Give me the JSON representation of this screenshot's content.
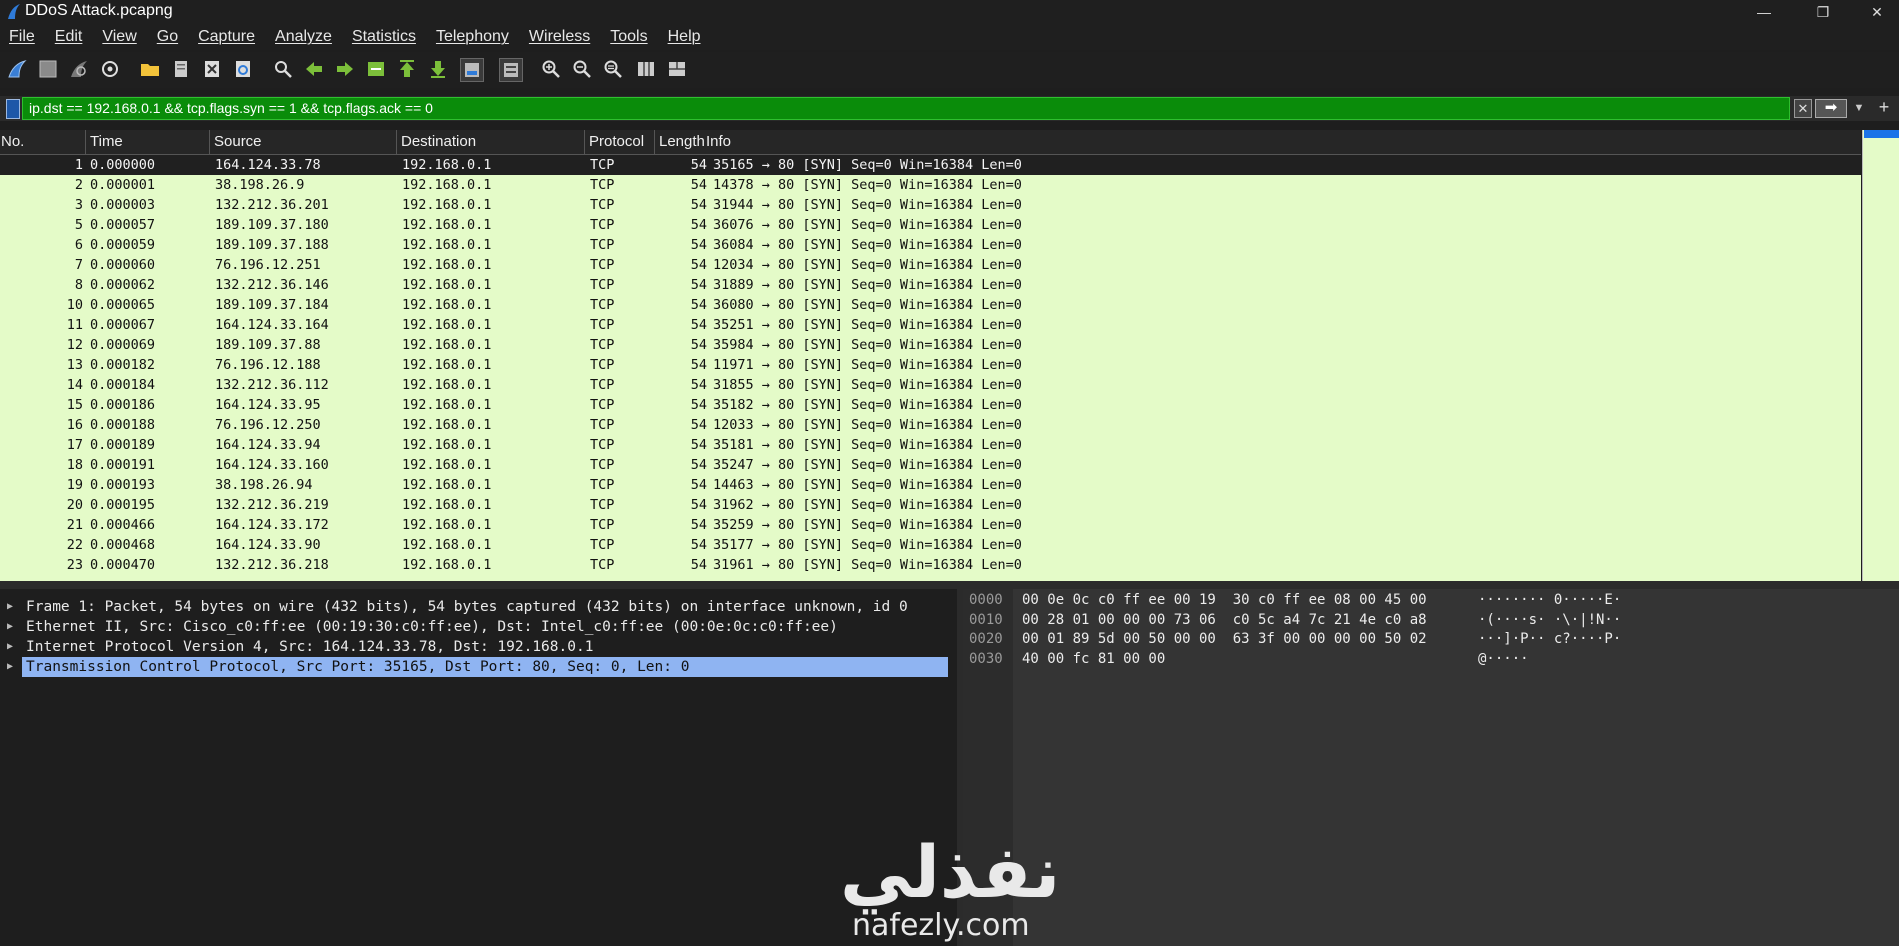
{
  "window": {
    "title": "DDoS Attack.pcapng",
    "minimize": "—",
    "restore": "❐",
    "close": "✕"
  },
  "menu": [
    "File",
    "Edit",
    "View",
    "Go",
    "Capture",
    "Analyze",
    "Statistics",
    "Telephony",
    "Wireless",
    "Tools",
    "Help"
  ],
  "toolbar_icons": [
    "shark-fin-start-icon",
    "stop-icon",
    "restart-icon",
    "capture-options-icon",
    "open-folder-icon",
    "open-recent-icon",
    "close-file-icon",
    "reload-icon",
    "find-packet-icon",
    "go-back-icon",
    "go-forward-icon",
    "go-to-packet-icon",
    "first-packet-icon",
    "last-packet-icon",
    "autoscroll-icon",
    "colorize-icon",
    "zoom-in-icon",
    "zoom-out-icon",
    "normal-size-icon",
    "resize-columns-icon",
    "layout-icon"
  ],
  "filter": {
    "expression": "ip.dst == 192.168.0.1 && tcp.flags.syn == 1 && tcp.flags.ack == 0",
    "clear": "✕",
    "apply": "➡",
    "dropdown": "▼",
    "add": "+"
  },
  "columns": [
    "No.",
    "Time",
    "Source",
    "Destination",
    "Protocol",
    "Length",
    "Info"
  ],
  "packets": [
    {
      "no": "1",
      "time": "0.000000",
      "src": "164.124.33.78",
      "dst": "192.168.0.1",
      "proto": "TCP",
      "len": "54",
      "info": "35165 → 80 [SYN] Seq=0 Win=16384 Len=0"
    },
    {
      "no": "2",
      "time": "0.000001",
      "src": "38.198.26.9",
      "dst": "192.168.0.1",
      "proto": "TCP",
      "len": "54",
      "info": "14378 → 80 [SYN] Seq=0 Win=16384 Len=0"
    },
    {
      "no": "3",
      "time": "0.000003",
      "src": "132.212.36.201",
      "dst": "192.168.0.1",
      "proto": "TCP",
      "len": "54",
      "info": "31944 → 80 [SYN] Seq=0 Win=16384 Len=0"
    },
    {
      "no": "5",
      "time": "0.000057",
      "src": "189.109.37.180",
      "dst": "192.168.0.1",
      "proto": "TCP",
      "len": "54",
      "info": "36076 → 80 [SYN] Seq=0 Win=16384 Len=0"
    },
    {
      "no": "6",
      "time": "0.000059",
      "src": "189.109.37.188",
      "dst": "192.168.0.1",
      "proto": "TCP",
      "len": "54",
      "info": "36084 → 80 [SYN] Seq=0 Win=16384 Len=0"
    },
    {
      "no": "7",
      "time": "0.000060",
      "src": "76.196.12.251",
      "dst": "192.168.0.1",
      "proto": "TCP",
      "len": "54",
      "info": "12034 → 80 [SYN] Seq=0 Win=16384 Len=0"
    },
    {
      "no": "8",
      "time": "0.000062",
      "src": "132.212.36.146",
      "dst": "192.168.0.1",
      "proto": "TCP",
      "len": "54",
      "info": "31889 → 80 [SYN] Seq=0 Win=16384 Len=0"
    },
    {
      "no": "10",
      "time": "0.000065",
      "src": "189.109.37.184",
      "dst": "192.168.0.1",
      "proto": "TCP",
      "len": "54",
      "info": "36080 → 80 [SYN] Seq=0 Win=16384 Len=0"
    },
    {
      "no": "11",
      "time": "0.000067",
      "src": "164.124.33.164",
      "dst": "192.168.0.1",
      "proto": "TCP",
      "len": "54",
      "info": "35251 → 80 [SYN] Seq=0 Win=16384 Len=0"
    },
    {
      "no": "12",
      "time": "0.000069",
      "src": "189.109.37.88",
      "dst": "192.168.0.1",
      "proto": "TCP",
      "len": "54",
      "info": "35984 → 80 [SYN] Seq=0 Win=16384 Len=0"
    },
    {
      "no": "13",
      "time": "0.000182",
      "src": "76.196.12.188",
      "dst": "192.168.0.1",
      "proto": "TCP",
      "len": "54",
      "info": "11971 → 80 [SYN] Seq=0 Win=16384 Len=0"
    },
    {
      "no": "14",
      "time": "0.000184",
      "src": "132.212.36.112",
      "dst": "192.168.0.1",
      "proto": "TCP",
      "len": "54",
      "info": "31855 → 80 [SYN] Seq=0 Win=16384 Len=0"
    },
    {
      "no": "15",
      "time": "0.000186",
      "src": "164.124.33.95",
      "dst": "192.168.0.1",
      "proto": "TCP",
      "len": "54",
      "info": "35182 → 80 [SYN] Seq=0 Win=16384 Len=0"
    },
    {
      "no": "16",
      "time": "0.000188",
      "src": "76.196.12.250",
      "dst": "192.168.0.1",
      "proto": "TCP",
      "len": "54",
      "info": "12033 → 80 [SYN] Seq=0 Win=16384 Len=0"
    },
    {
      "no": "17",
      "time": "0.000189",
      "src": "164.124.33.94",
      "dst": "192.168.0.1",
      "proto": "TCP",
      "len": "54",
      "info": "35181 → 80 [SYN] Seq=0 Win=16384 Len=0"
    },
    {
      "no": "18",
      "time": "0.000191",
      "src": "164.124.33.160",
      "dst": "192.168.0.1",
      "proto": "TCP",
      "len": "54",
      "info": "35247 → 80 [SYN] Seq=0 Win=16384 Len=0"
    },
    {
      "no": "19",
      "time": "0.000193",
      "src": "38.198.26.94",
      "dst": "192.168.0.1",
      "proto": "TCP",
      "len": "54",
      "info": "14463 → 80 [SYN] Seq=0 Win=16384 Len=0"
    },
    {
      "no": "20",
      "time": "0.000195",
      "src": "132.212.36.219",
      "dst": "192.168.0.1",
      "proto": "TCP",
      "len": "54",
      "info": "31962 → 80 [SYN] Seq=0 Win=16384 Len=0"
    },
    {
      "no": "21",
      "time": "0.000466",
      "src": "164.124.33.172",
      "dst": "192.168.0.1",
      "proto": "TCP",
      "len": "54",
      "info": "35259 → 80 [SYN] Seq=0 Win=16384 Len=0"
    },
    {
      "no": "22",
      "time": "0.000468",
      "src": "164.124.33.90",
      "dst": "192.168.0.1",
      "proto": "TCP",
      "len": "54",
      "info": "35177 → 80 [SYN] Seq=0 Win=16384 Len=0"
    },
    {
      "no": "23",
      "time": "0.000470",
      "src": "132.212.36.218",
      "dst": "192.168.0.1",
      "proto": "TCP",
      "len": "54",
      "info": "31961 → 80 [SYN] Seq=0 Win=16384 Len=0"
    }
  ],
  "selected_packet": 0,
  "details": [
    {
      "arrow": "▶",
      "text": "Frame 1: Packet, 54 bytes on wire (432 bits), 54 bytes captured (432 bits) on interface unknown, id 0"
    },
    {
      "arrow": "▶",
      "text": "Ethernet II, Src: Cisco_c0:ff:ee (00:19:30:c0:ff:ee), Dst: Intel_c0:ff:ee (00:0e:0c:c0:ff:ee)"
    },
    {
      "arrow": "▶",
      "text": "Internet Protocol Version 4, Src: 164.124.33.78, Dst: 192.168.0.1"
    },
    {
      "arrow": "▶",
      "text": "Transmission Control Protocol, Src Port: 35165, Dst Port: 80, Seq: 0, Len: 0"
    }
  ],
  "selected_detail": 3,
  "bytes": [
    {
      "offset": "0000",
      "hex": "00 0e 0c c0 ff ee 00 19  30 c0 ff ee 08 00 45 00",
      "ascii": "········ 0·····E·"
    },
    {
      "offset": "0010",
      "hex": "00 28 01 00 00 00 73 06  c0 5c a4 7c 21 4e c0 a8",
      "ascii": "·(····s· ·\\·|!N··"
    },
    {
      "offset": "0020",
      "hex": "00 01 89 5d 00 50 00 00  63 3f 00 00 00 00 50 02",
      "ascii": "···]·P·· c?····P·"
    },
    {
      "offset": "0030",
      "hex": "40 00 fc 81 00 00",
      "ascii": "@·····"
    }
  ],
  "watermark": {
    "arabic": "نفذلي",
    "latin": "nafezly.com"
  },
  "colors": {
    "row_bg": "#e4fbc8",
    "filter_ok": "#0a8c0a",
    "selected_detail": "#8fb4f2",
    "scroll_thumb": "#1a73e8"
  }
}
